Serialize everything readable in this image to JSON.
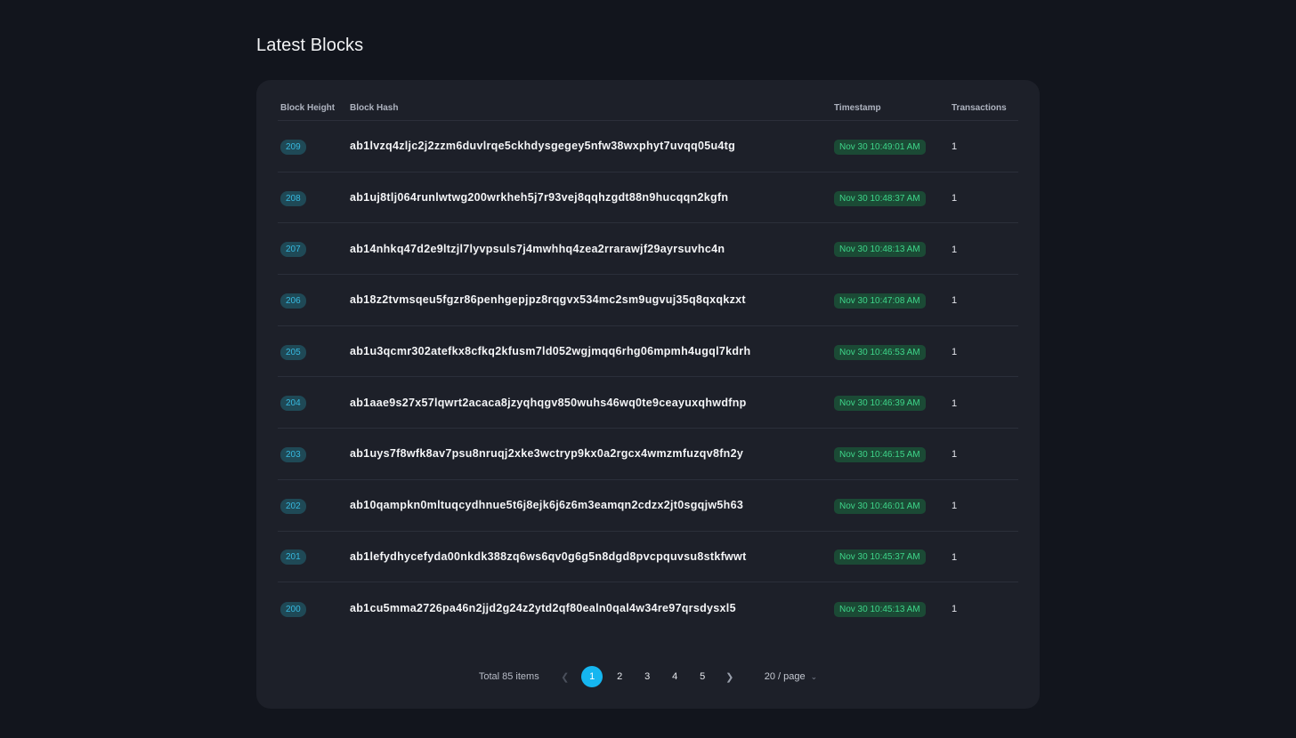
{
  "page_title": "Latest Blocks",
  "table": {
    "headers": {
      "height": "Block Height",
      "hash": "Block Hash",
      "timestamp": "Timestamp",
      "transactions": "Transactions"
    },
    "rows": [
      {
        "height": "209",
        "hash": "ab1lvzq4zljc2j2zzm6duvlrqe5ckhdysgegey5nfw38wxphyt7uvqq05u4tg",
        "timestamp": "Nov 30 10:49:01 AM",
        "transactions": "1"
      },
      {
        "height": "208",
        "hash": "ab1uj8tlj064runlwtwg200wrkheh5j7r93vej8qqhzgdt88n9hucqqn2kgfn",
        "timestamp": "Nov 30 10:48:37 AM",
        "transactions": "1"
      },
      {
        "height": "207",
        "hash": "ab14nhkq47d2e9ltzjl7lyvpsuls7j4mwhhq4zea2rrarawjf29ayrsuvhc4n",
        "timestamp": "Nov 30 10:48:13 AM",
        "transactions": "1"
      },
      {
        "height": "206",
        "hash": "ab18z2tvmsqeu5fgzr86penhgepjpz8rqgvx534mc2sm9ugvuj35q8qxqkzxt",
        "timestamp": "Nov 30 10:47:08 AM",
        "transactions": "1"
      },
      {
        "height": "205",
        "hash": "ab1u3qcmr302atefkx8cfkq2kfusm7ld052wgjmqq6rhg06mpmh4ugql7kdrh",
        "timestamp": "Nov 30 10:46:53 AM",
        "transactions": "1"
      },
      {
        "height": "204",
        "hash": "ab1aae9s27x57lqwrt2acaca8jzyqhqgv850wuhs46wq0te9ceayuxqhwdfnp",
        "timestamp": "Nov 30 10:46:39 AM",
        "transactions": "1"
      },
      {
        "height": "203",
        "hash": "ab1uys7f8wfk8av7psu8nruqj2xke3wctryp9kx0a2rgcx4wmzmfuzqv8fn2y",
        "timestamp": "Nov 30 10:46:15 AM",
        "transactions": "1"
      },
      {
        "height": "202",
        "hash": "ab10qampkn0mltuqcydhnue5t6j8ejk6j6z6m3eamqn2cdzx2jt0sgqjw5h63",
        "timestamp": "Nov 30 10:46:01 AM",
        "transactions": "1"
      },
      {
        "height": "201",
        "hash": "ab1lefydhycefyda00nkdk388zq6ws6qv0g6g5n8dgd8pvcpquvsu8stkfwwt",
        "timestamp": "Nov 30 10:45:37 AM",
        "transactions": "1"
      },
      {
        "height": "200",
        "hash": "ab1cu5mma2726pa46n2jjd2g24z2ytd2qf80ealn0qal4w34re97qrsdysxl5",
        "timestamp": "Nov 30 10:45:13 AM",
        "transactions": "1"
      }
    ]
  },
  "pagination": {
    "total_label": "Total 85 items",
    "prev_icon": "chevron-left-icon",
    "next_icon": "chevron-right-icon",
    "pages": [
      "1",
      "2",
      "3",
      "4",
      "5"
    ],
    "current_page": "1",
    "page_size": "20 / page",
    "page_size_icon": "chevron-down-icon"
  },
  "colors": {
    "background": "#12151d",
    "card": "#1d2029",
    "height_badge_bg": "#1f4956",
    "height_badge_text": "#37b9e0",
    "timestamp_badge_bg": "#1b4a35",
    "timestamp_badge_text": "#3ed68a",
    "active_page": "#15b6f0"
  }
}
